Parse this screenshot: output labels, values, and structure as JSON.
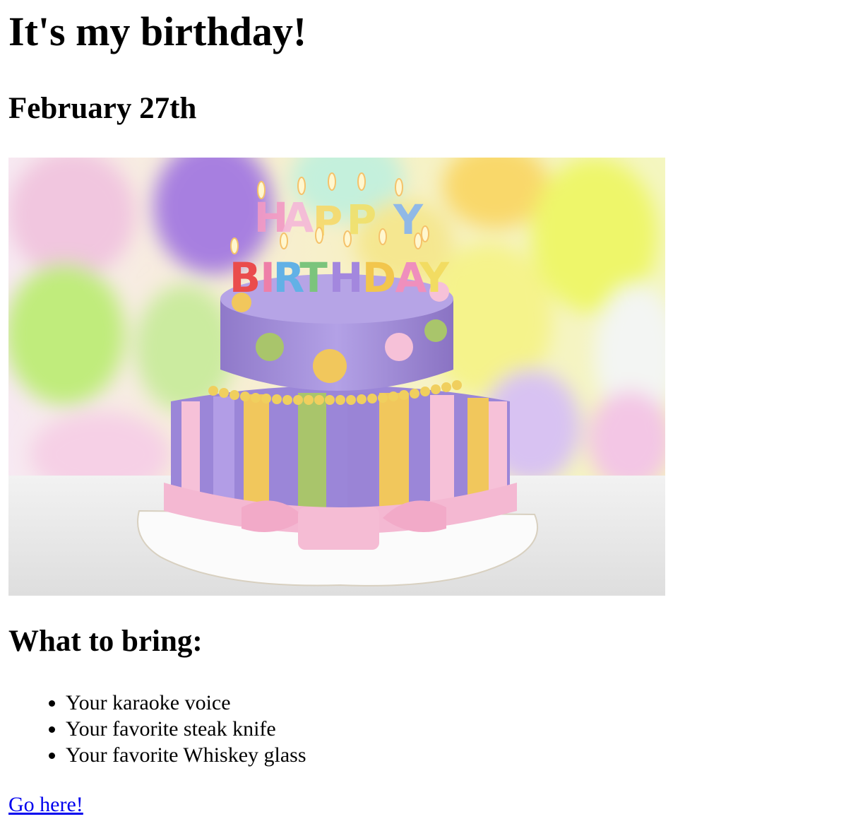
{
  "heading": "It's my birthday!",
  "date": "February 27th",
  "image": {
    "candle_text_top": "HAPPY",
    "candle_text_bottom": "BIRTHDAY"
  },
  "bring_heading": "What to bring:",
  "bring_items": [
    "Your karaoke voice",
    "Your favorite steak knife",
    "Your favorite Whiskey glass"
  ],
  "link_text": "Go here!",
  "colors": {
    "link": "#0000ee",
    "text": "#000000",
    "background": "#ffffff",
    "cake_purple": "#a08bd6",
    "cake_pink": "#f3b7cf",
    "cake_yellow": "#f2c85a",
    "cake_green": "#a8c46a"
  }
}
